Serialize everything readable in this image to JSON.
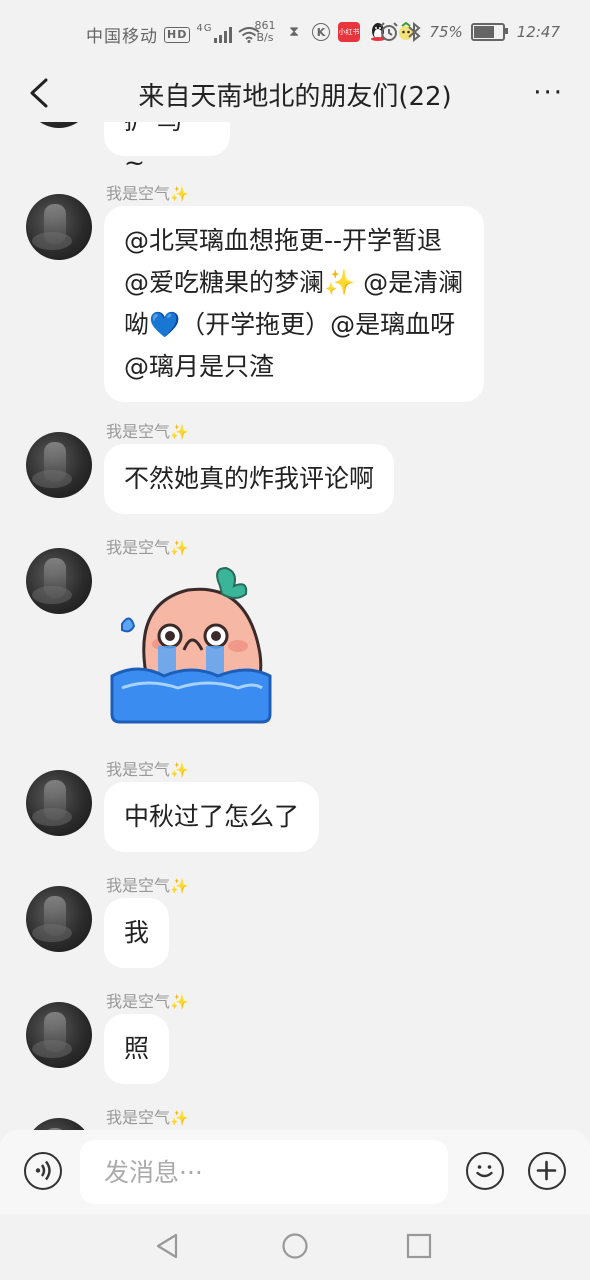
{
  "status_bar": {
    "carrier": "中国移动",
    "hd": "HD",
    "signal": "4G",
    "net_speed_value": "861",
    "net_speed_unit": "B/s",
    "app_badge": "小红书",
    "battery": "75%",
    "battery_level": 0.75,
    "time": "12:47"
  },
  "header": {
    "title": "来自天南地北的朋友们(22)",
    "more": "···"
  },
  "chat": {
    "partial_top_text": "扩 鸟 ~",
    "messages": [
      {
        "sender": "我是空气",
        "spark": "✨",
        "text": "@北冥璃血想拖更--开学暂退 @爱吃糖果的梦澜✨ @是清澜呦💙（开学拖更）@是璃血呀 @璃月是只渣"
      },
      {
        "sender": "我是空气",
        "spark": "✨",
        "text": "不然她真的炸我评论啊"
      },
      {
        "sender": "我是空气",
        "spark": "✨",
        "sticker": "crying-peach-sticker"
      },
      {
        "sender": "我是空气",
        "spark": "✨",
        "text": "中秋过了怎么了"
      },
      {
        "sender": "我是空气",
        "spark": "✨",
        "text": "我"
      },
      {
        "sender": "我是空气",
        "spark": "✨",
        "text": "照"
      },
      {
        "sender": "我是空气",
        "spark": "✨"
      }
    ]
  },
  "input": {
    "placeholder": "发消息···"
  },
  "colors": {
    "background": "#f2f2f2",
    "bubble": "#ffffff",
    "spark": "#f3c22a",
    "sticker_blue": "#3a8cf0"
  }
}
